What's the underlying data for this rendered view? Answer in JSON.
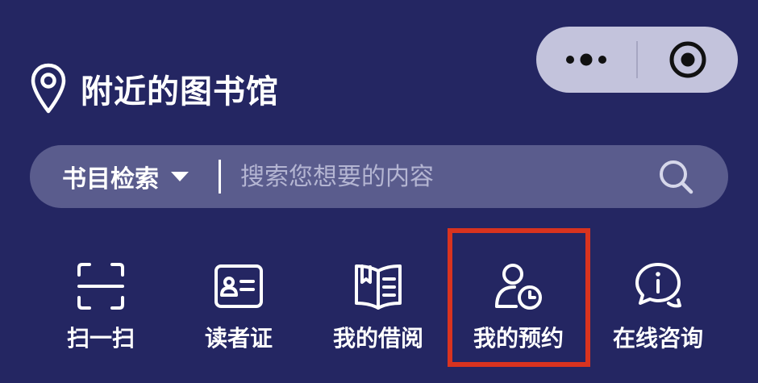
{
  "header": {
    "title": "附近的图书馆",
    "location_icon": "location-pin-icon"
  },
  "capsule": {
    "more_icon": "more-dots-icon",
    "close_icon": "target-close-icon"
  },
  "search": {
    "category_label": "书目检索",
    "placeholder": "搜索您想要的内容",
    "search_icon": "search-icon"
  },
  "actions": [
    {
      "label": "扫一扫",
      "icon": "scan-icon"
    },
    {
      "label": "读者证",
      "icon": "reader-card-icon"
    },
    {
      "label": "我的借阅",
      "icon": "book-borrow-icon"
    },
    {
      "label": "我的预约",
      "icon": "user-clock-icon"
    },
    {
      "label": "在线咨询",
      "icon": "chat-info-icon"
    }
  ],
  "colors": {
    "background": "#242662",
    "search_bar": "#5a5c8d",
    "capsule": "#c3c3dc",
    "highlight": "#d9331f"
  }
}
